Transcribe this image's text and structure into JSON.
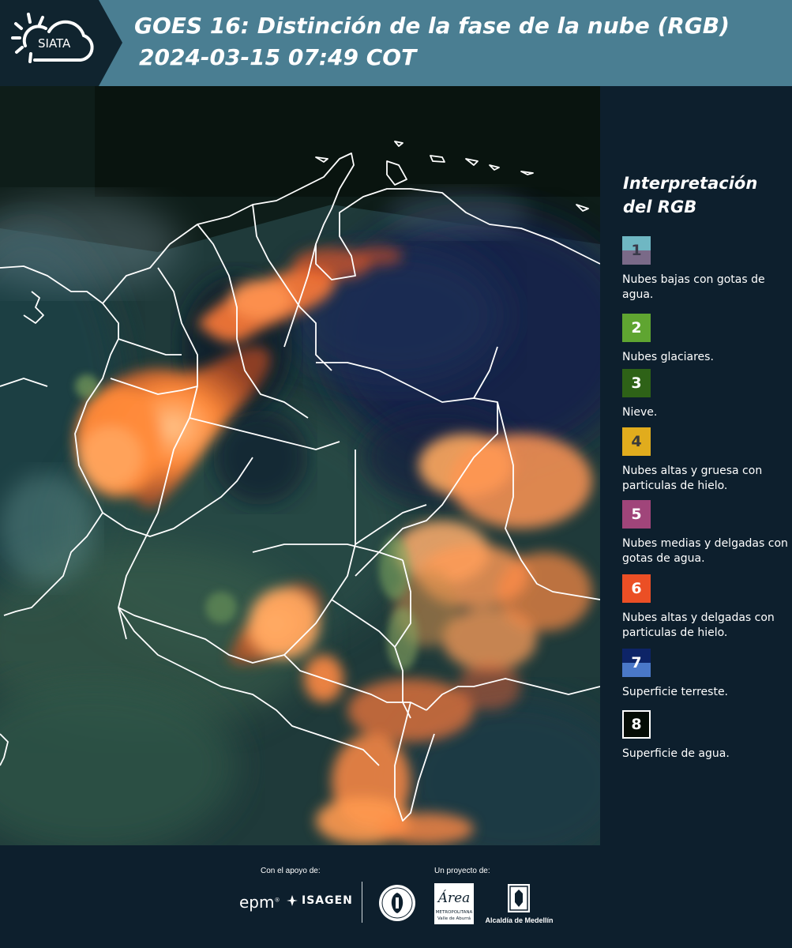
{
  "header": {
    "logo_text": "SIATA",
    "title": "GOES 16: Distinción de la fase de la nube (RGB)",
    "subtitle": "2024-03-15 07:49 COT"
  },
  "legend": {
    "title": "Interpretación del RGB",
    "items": [
      {
        "number": "1",
        "label": "Nubes bajas con gotas de agua.",
        "colors": [
          "#6fb7c3",
          "#7a6a88"
        ],
        "text_color": "#3a3a4a"
      },
      {
        "number": "2",
        "label": "Nubes glaciares.",
        "colors": [
          "#5fa531"
        ],
        "text_color": "#ffffff"
      },
      {
        "number": "3",
        "label": "Nieve.",
        "colors": [
          "#2e6217"
        ],
        "text_color": "#ffffff"
      },
      {
        "number": "4",
        "label": "Nubes altas y gruesa con particulas de hielo.",
        "colors": [
          "#e1ac1d"
        ],
        "text_color": "#3a3a3a"
      },
      {
        "number": "5",
        "label": "Nubes medias y delgadas con gotas de agua.",
        "colors": [
          "#a0457a"
        ],
        "text_color": "#ffffff"
      },
      {
        "number": "6",
        "label": "Nubes altas y delgadas con particulas de hielo.",
        "colors": [
          "#eb4f25"
        ],
        "text_color": "#ffffff"
      },
      {
        "number": "7",
        "label": "Superficie terreste.",
        "colors": [
          "#0d2467",
          "#4a78c8"
        ],
        "text_color": "#ffffff"
      },
      {
        "number": "8",
        "label": "Superficie de agua.",
        "colors": [
          "#050c05"
        ],
        "text_color": "#ffffff"
      }
    ]
  },
  "footer": {
    "support_label": "Con el apoyo de:",
    "project_label": "Un proyecto de:",
    "epm": "epm",
    "isagen": "ISAGEN",
    "area_name": "Área",
    "area_sub": "METROPOLITANA",
    "area_sub2": "Valle de Aburrá",
    "alcaldia": "Alcaldía de Medellín"
  }
}
